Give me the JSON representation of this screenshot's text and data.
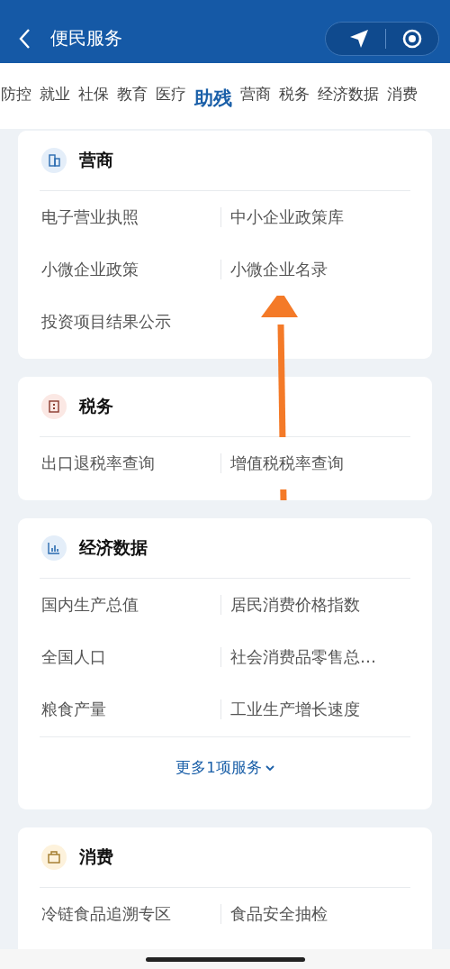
{
  "header": {
    "title": "便民服务"
  },
  "tabs": [
    {
      "label": "防控",
      "selected": false
    },
    {
      "label": "就业",
      "selected": false
    },
    {
      "label": "社保",
      "selected": false
    },
    {
      "label": "教育",
      "selected": false
    },
    {
      "label": "医疗",
      "selected": false
    },
    {
      "label": "助残",
      "selected": true
    },
    {
      "label": "营商",
      "selected": false
    },
    {
      "label": "税务",
      "selected": false
    },
    {
      "label": "经济数据",
      "selected": false
    },
    {
      "label": "消费",
      "selected": false
    }
  ],
  "sections": [
    {
      "title": "营商",
      "kind": "building",
      "items": [
        "电子营业执照",
        "中小企业政策库",
        "小微企业政策",
        "小微企业名录",
        "投资项目结果公示"
      ]
    },
    {
      "title": "税务",
      "kind": "receipt",
      "items": [
        "出口退税率查询",
        "增值税税率查询"
      ]
    },
    {
      "title": "经济数据",
      "kind": "chart",
      "items": [
        "国内生产总值",
        "居民消费价格指数",
        "全国人口",
        "社会消费品零售总…",
        "粮食产量",
        "工业生产增长速度"
      ],
      "more": "更多1项服务"
    },
    {
      "title": "消费",
      "kind": "bag",
      "items": [
        "冷链食品追溯专区",
        "食品安全抽检"
      ]
    }
  ]
}
